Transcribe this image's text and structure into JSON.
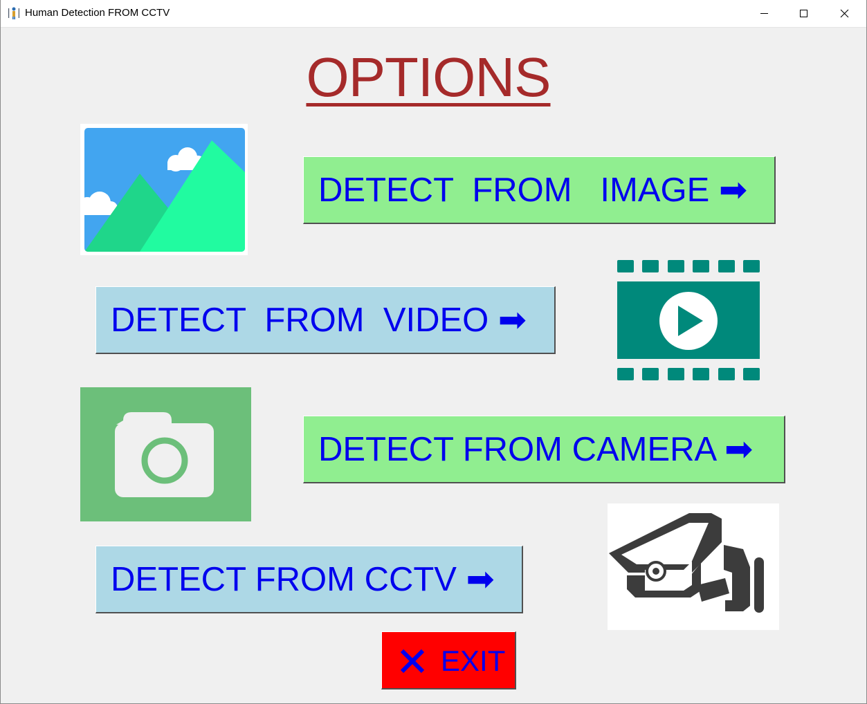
{
  "window": {
    "title": "Human Detection FROM CCTV",
    "controls": [
      "minimize",
      "maximize",
      "close"
    ]
  },
  "heading": "OPTIONS",
  "options": [
    {
      "label": "DETECT  FROM   IMAGE ➡",
      "color": "#90ee90",
      "icon": "image-icon"
    },
    {
      "label": "DETECT  FROM  VIDEO ➡",
      "color": "#add8e6",
      "icon": "video-icon"
    },
    {
      "label": "DETECT FROM CAMERA ➡",
      "color": "#90ee90",
      "icon": "camera-icon"
    },
    {
      "label": "DETECT FROM CCTV ➡",
      "color": "#add8e6",
      "icon": "cctv-camera-icon"
    }
  ],
  "exit": {
    "label": "EXIT",
    "color": "#ff0000"
  },
  "colors": {
    "heading": "#a52a2a",
    "button_text": "#0000ee",
    "background": "#f0f0f0"
  }
}
